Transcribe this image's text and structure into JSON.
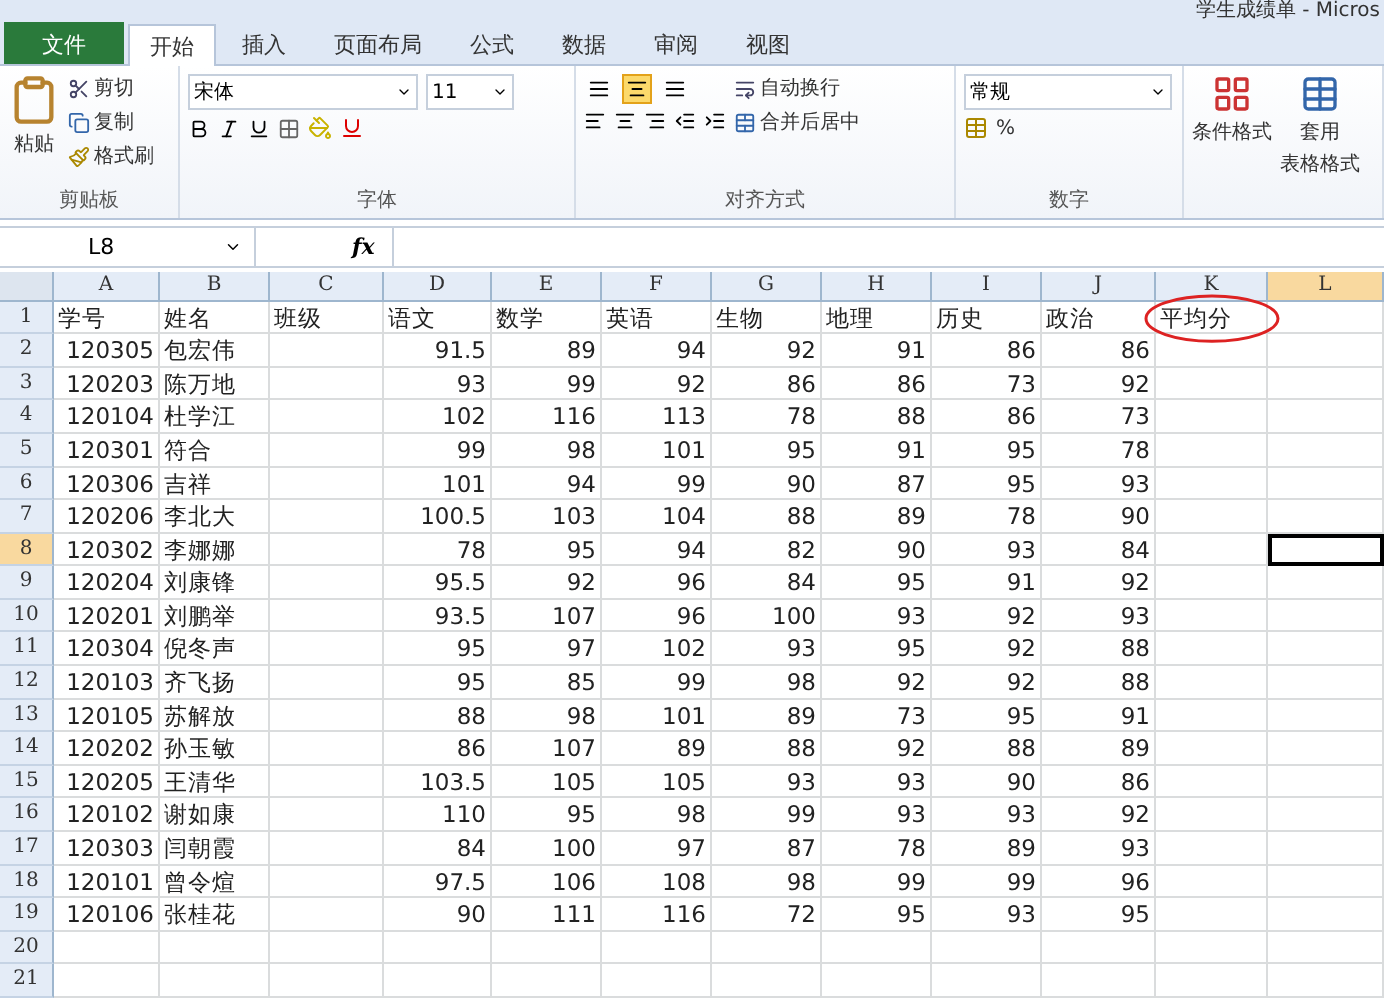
{
  "window": {
    "title": "学生成绩单 - Micros"
  },
  "tabs": [
    {
      "label": "文件",
      "selected": false,
      "kind": "file"
    },
    {
      "label": "开始",
      "selected": true,
      "kind": "tab"
    },
    {
      "label": "插入",
      "selected": false,
      "kind": "tab"
    },
    {
      "label": "页面布局",
      "selected": false,
      "kind": "tab"
    },
    {
      "label": "公式",
      "selected": false,
      "kind": "tab"
    },
    {
      "label": "数据",
      "selected": false,
      "kind": "tab"
    },
    {
      "label": "审阅",
      "selected": false,
      "kind": "tab"
    },
    {
      "label": "视图",
      "selected": false,
      "kind": "tab"
    }
  ],
  "ribbon": {
    "clipboard": {
      "paste": "粘贴",
      "cut": "剪切",
      "copy": "复制",
      "format_painter": "格式刷",
      "label": "剪贴板"
    },
    "font": {
      "name": "宋体",
      "size": "11",
      "label": "字体"
    },
    "alignment": {
      "wrap": "自动换行",
      "merge": "合并后居中",
      "label": "对齐方式"
    },
    "number": {
      "format": "常规",
      "percent": "%",
      "label": "数字"
    },
    "styles": {
      "conditional": "条件格式",
      "table_format_1": "套用",
      "table_format_2": "表格格式"
    }
  },
  "formula_bar": {
    "name_box": "L8",
    "fx": "fx"
  },
  "sheet": {
    "columns": [
      {
        "label": "A",
        "selected": false
      },
      {
        "label": "B",
        "selected": false
      },
      {
        "label": "C",
        "selected": false
      },
      {
        "label": "D",
        "selected": false
      },
      {
        "label": "E",
        "selected": false
      },
      {
        "label": "F",
        "selected": false
      },
      {
        "label": "G",
        "selected": false
      },
      {
        "label": "H",
        "selected": false
      },
      {
        "label": "I",
        "selected": false
      },
      {
        "label": "J",
        "selected": false
      },
      {
        "label": "K",
        "selected": false
      },
      {
        "label": "L",
        "selected": true
      }
    ],
    "rows": [
      {
        "number": "1",
        "selected": false,
        "cells": [
          "学号",
          "姓名",
          "班级",
          "语文",
          "数学",
          "英语",
          "生物",
          "地理",
          "历史",
          "政治",
          "平均分"
        ]
      },
      {
        "number": "2",
        "selected": false,
        "cells": [
          "120305",
          "包宏伟",
          "",
          "91.5",
          "89",
          "94",
          "92",
          "91",
          "86",
          "86"
        ]
      },
      {
        "number": "3",
        "selected": false,
        "cells": [
          "120203",
          "陈万地",
          "",
          "93",
          "99",
          "92",
          "86",
          "86",
          "73",
          "92"
        ]
      },
      {
        "number": "4",
        "selected": false,
        "cells": [
          "120104",
          "杜学江",
          "",
          "102",
          "116",
          "113",
          "78",
          "88",
          "86",
          "73"
        ]
      },
      {
        "number": "5",
        "selected": false,
        "cells": [
          "120301",
          "符合",
          "",
          "99",
          "98",
          "101",
          "95",
          "91",
          "95",
          "78"
        ]
      },
      {
        "number": "6",
        "selected": false,
        "cells": [
          "120306",
          "吉祥",
          "",
          "101",
          "94",
          "99",
          "90",
          "87",
          "95",
          "93"
        ]
      },
      {
        "number": "7",
        "selected": false,
        "cells": [
          "120206",
          "李北大",
          "",
          "100.5",
          "103",
          "104",
          "88",
          "89",
          "78",
          "90"
        ]
      },
      {
        "number": "8",
        "selected": true,
        "cells": [
          "120302",
          "李娜娜",
          "",
          "78",
          "95",
          "94",
          "82",
          "90",
          "93",
          "84"
        ]
      },
      {
        "number": "9",
        "selected": false,
        "cells": [
          "120204",
          "刘康锋",
          "",
          "95.5",
          "92",
          "96",
          "84",
          "95",
          "91",
          "92"
        ]
      },
      {
        "number": "10",
        "selected": false,
        "cells": [
          "120201",
          "刘鹏举",
          "",
          "93.5",
          "107",
          "96",
          "100",
          "93",
          "92",
          "93"
        ]
      },
      {
        "number": "11",
        "selected": false,
        "cells": [
          "120304",
          "倪冬声",
          "",
          "95",
          "97",
          "102",
          "93",
          "95",
          "92",
          "88"
        ]
      },
      {
        "number": "12",
        "selected": false,
        "cells": [
          "120103",
          "齐飞扬",
          "",
          "95",
          "85",
          "99",
          "98",
          "92",
          "92",
          "88"
        ]
      },
      {
        "number": "13",
        "selected": false,
        "cells": [
          "120105",
          "苏解放",
          "",
          "88",
          "98",
          "101",
          "89",
          "73",
          "95",
          "91"
        ]
      },
      {
        "number": "14",
        "selected": false,
        "cells": [
          "120202",
          "孙玉敏",
          "",
          "86",
          "107",
          "89",
          "88",
          "92",
          "88",
          "89"
        ]
      },
      {
        "number": "15",
        "selected": false,
        "cells": [
          "120205",
          "王清华",
          "",
          "103.5",
          "105",
          "105",
          "93",
          "93",
          "90",
          "86"
        ]
      },
      {
        "number": "16",
        "selected": false,
        "cells": [
          "120102",
          "谢如康",
          "",
          "110",
          "95",
          "98",
          "99",
          "93",
          "93",
          "92"
        ]
      },
      {
        "number": "17",
        "selected": false,
        "cells": [
          "120303",
          "闫朝霞",
          "",
          "84",
          "100",
          "97",
          "87",
          "78",
          "89",
          "93"
        ]
      },
      {
        "number": "18",
        "selected": false,
        "cells": [
          "120101",
          "曾令煊",
          "",
          "97.5",
          "106",
          "108",
          "98",
          "99",
          "99",
          "96"
        ]
      },
      {
        "number": "19",
        "selected": false,
        "cells": [
          "120106",
          "张桂花",
          "",
          "90",
          "111",
          "116",
          "72",
          "95",
          "93",
          "95"
        ]
      },
      {
        "number": "20",
        "selected": false
      },
      {
        "number": "21",
        "selected": false
      }
    ]
  }
}
